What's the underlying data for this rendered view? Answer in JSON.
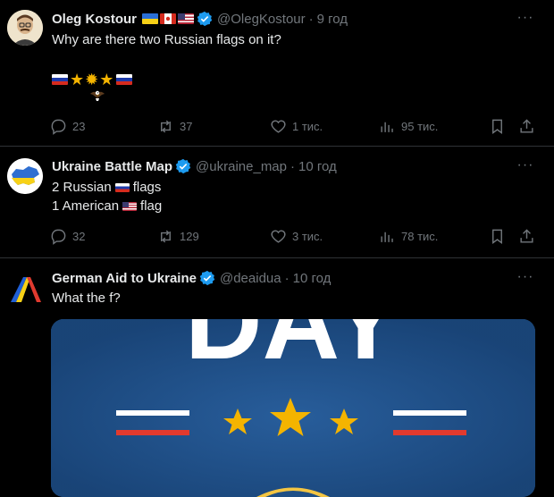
{
  "tweets": [
    {
      "name": "Oleg Kostour",
      "handle": "@OlegKostour",
      "time": "9 год",
      "text": "Why are there two Russian flags on it?",
      "stats": {
        "replies": "23",
        "retweets": "37",
        "likes": "1 тис.",
        "views": "95 тис."
      }
    },
    {
      "name": "Ukraine Battle Map",
      "handle": "@ukraine_map",
      "time": "10 год",
      "line1_prefix": "2 Russian",
      "line1_suffix": "flags",
      "line2_prefix": "1 American",
      "line2_suffix": "flag",
      "stats": {
        "replies": "32",
        "retweets": "129",
        "likes": "3 тис.",
        "views": "78 тис."
      }
    },
    {
      "name": "German Aid to Ukraine",
      "handle": "@deaidua",
      "time": "10 год",
      "text": "What the f?",
      "image_text": "DAY"
    }
  ],
  "separator": "·",
  "colors": {
    "background": "#000000",
    "verified": "#1d9bf0",
    "muted": "#71767b",
    "divider": "#2f3336",
    "star": "#f4b400"
  }
}
